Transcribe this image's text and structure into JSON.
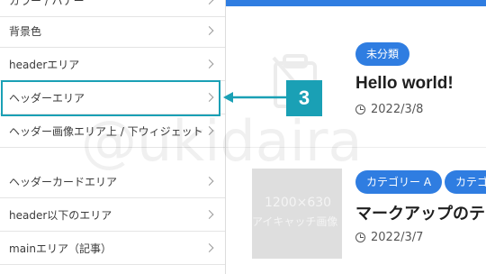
{
  "sidebar": {
    "items": [
      {
        "label": "カラー / バナー"
      },
      {
        "label": "背景色"
      },
      {
        "label": "headerエリア"
      },
      {
        "label": "ヘッダーエリア"
      },
      {
        "label": "ヘッダー画像エリア上 / 下ウィジェット"
      },
      {
        "label": "ヘッダーカードエリア"
      },
      {
        "label": "header以下のエリア"
      },
      {
        "label": "mainエリア（記事）"
      }
    ]
  },
  "step_marker": {
    "number": "3",
    "color": "#1aa0b5"
  },
  "posts": [
    {
      "category": "未分類",
      "title": "Hello world!",
      "date": "2022/3/8"
    },
    {
      "categories": [
        "カテゴリー A",
        "カテゴ"
      ],
      "title": "マークアップのテ",
      "date": "2022/3/7",
      "thumbnail": {
        "line1": "1200×630",
        "line2": "アイキャッチ画像"
      }
    }
  ],
  "watermark": "@ukidaira",
  "accent_color": "#2f7de1"
}
